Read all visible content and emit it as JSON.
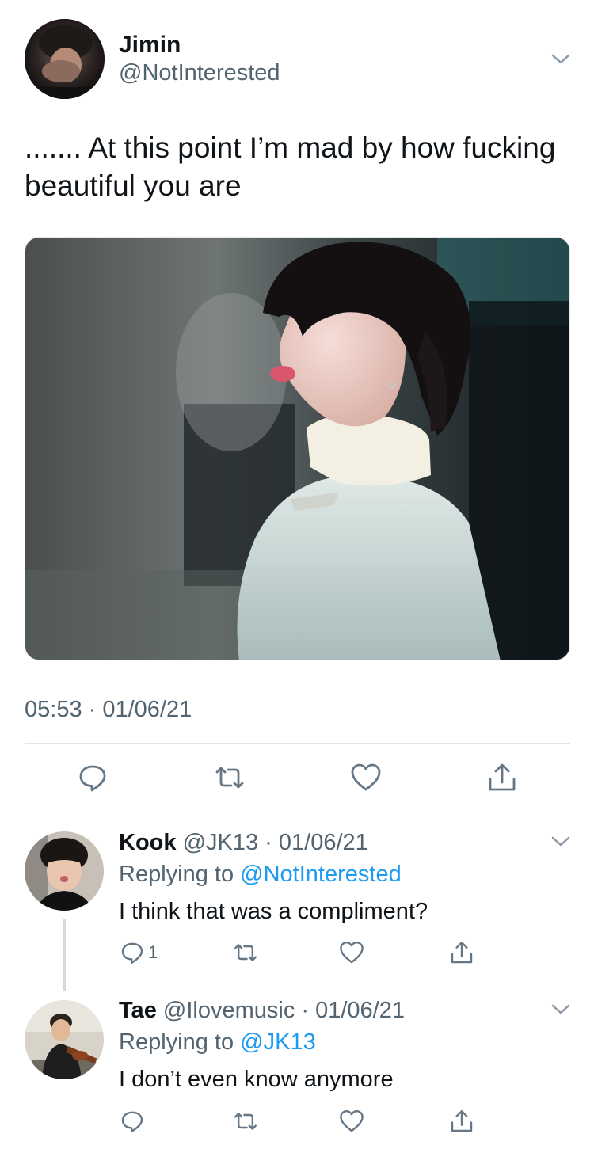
{
  "main_tweet": {
    "author_name": "Jimin",
    "author_handle": "@NotInterested",
    "text": "....... At this point I’m mad by how fucking beautiful you are",
    "timestamp": "05:53 · 01/06/21"
  },
  "replies": [
    {
      "name": "Kook",
      "handle": "@JK13",
      "date": "· 01/06/21",
      "replying_prefix": "Replying to",
      "replying_to": "@NotInterested",
      "text": "I think that was a compliment?",
      "reply_count": "1"
    },
    {
      "name": "Tae",
      "handle": "@Ilovemusic",
      "date": "· 01/06/21",
      "replying_prefix": "Replying to",
      "replying_to": "@JK13",
      "text": "I don’t even know anymore",
      "reply_count": ""
    }
  ],
  "icons": {
    "reply": "reply-icon",
    "retweet": "retweet-icon",
    "like": "heart-icon",
    "share": "share-icon",
    "more": "chevron-down-icon"
  },
  "colors": {
    "text": "#0f1419",
    "secondary": "#536471",
    "link": "#1d9bf0",
    "divider": "#e1e4e6"
  }
}
